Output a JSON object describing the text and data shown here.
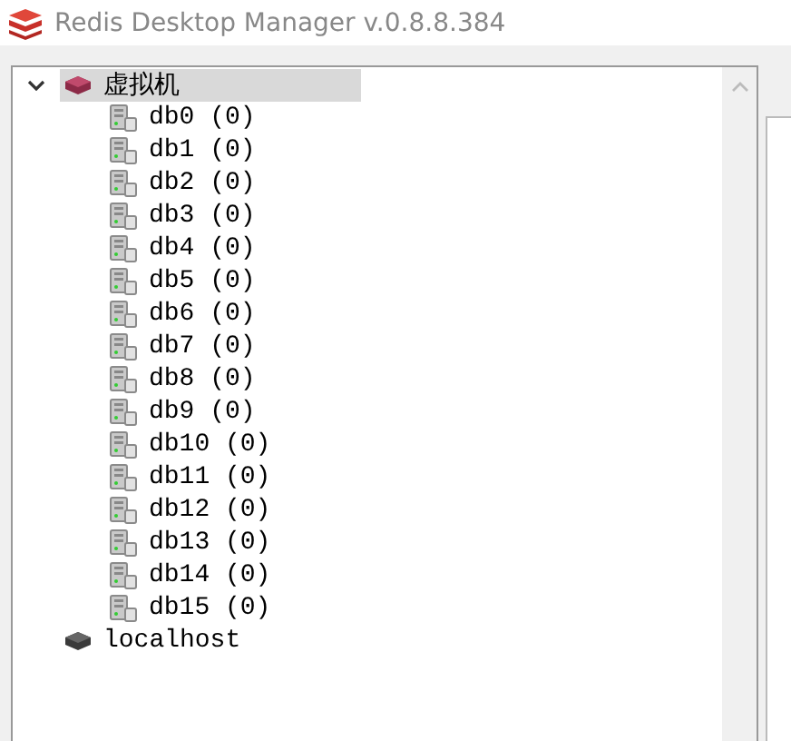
{
  "window": {
    "title": "Redis Desktop Manager v.0.8.8.384"
  },
  "tree": [
    {
      "label": "虚拟机",
      "connected": true,
      "expanded": true,
      "selected": true,
      "children": [
        {
          "label": "db0 (0)"
        },
        {
          "label": "db1 (0)"
        },
        {
          "label": "db2 (0)"
        },
        {
          "label": "db3 (0)"
        },
        {
          "label": "db4 (0)"
        },
        {
          "label": "db5 (0)"
        },
        {
          "label": "db6 (0)"
        },
        {
          "label": "db7 (0)"
        },
        {
          "label": "db8 (0)"
        },
        {
          "label": "db9 (0)"
        },
        {
          "label": "db10 (0)"
        },
        {
          "label": "db11 (0)"
        },
        {
          "label": "db12 (0)"
        },
        {
          "label": "db13 (0)"
        },
        {
          "label": "db14 (0)"
        },
        {
          "label": "db15 (0)"
        }
      ]
    },
    {
      "label": "localhost",
      "connected": false,
      "expanded": false,
      "selected": false
    }
  ]
}
